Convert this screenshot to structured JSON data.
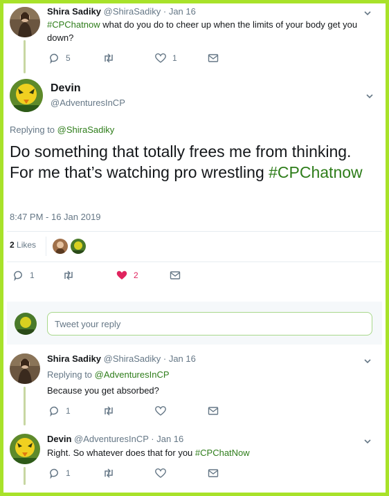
{
  "tweet1": {
    "name": "Shira Sadiky",
    "handle": "@ShiraSadiky",
    "date": "· Jan 16",
    "hashtag": "#CPChatnow",
    "text": " what do you do to cheer up when the limits of your body get you down?",
    "replies": "5",
    "retweets": "",
    "likes": "1"
  },
  "main": {
    "name": "Devin",
    "handle": "@AdventuresInCP",
    "replying_prefix": "Replying to ",
    "replying_to": "@ShiraSadiky",
    "text": "Do something that totally frees me from thinking. For me that’s watching pro wrestling ",
    "hashtag": "#CPChatnow",
    "timestamp": "8:47 PM - 16 Jan 2019",
    "likes_count": "2",
    "likes_label": " Likes",
    "replies": "1",
    "hearts": "2"
  },
  "reply_box": {
    "placeholder": "Tweet your reply"
  },
  "tweet2": {
    "name": "Shira Sadiky",
    "handle": "@ShiraSadiky",
    "date": "· Jan 16",
    "replying_prefix": "Replying to ",
    "replying_to": "@AdventuresInCP",
    "text": "Because you get absorbed?",
    "replies": "1"
  },
  "tweet3": {
    "name": "Devin",
    "handle": "@AdventuresInCP",
    "date": "· Jan 16",
    "text": "Right. So whatever does that for you ",
    "hashtag": "#CPChatNow",
    "replies": "1"
  },
  "colors": {
    "border": "#a8e22a",
    "link": "#2e7d1a",
    "heart": "#e0245e"
  }
}
